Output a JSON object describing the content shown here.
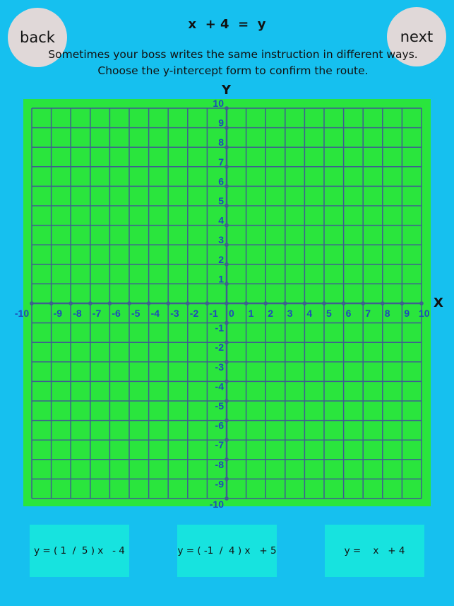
{
  "nav": {
    "back_label": "back",
    "next_label": "next"
  },
  "equation": "x  + 4  =  y",
  "instruction": "Sometimes your boss writes the same instruction in different ways. Choose the y-intercept form to confirm the route.",
  "graph": {
    "x_axis_label": "X",
    "y_axis_label": "Y",
    "x_range": [
      -10,
      10
    ],
    "y_range": [
      -10,
      10
    ],
    "step": 1,
    "x_ticks": [
      "-10",
      "-9",
      "-8",
      "-7",
      "-6",
      "-5",
      "-4",
      "-3",
      "-2",
      "-1",
      "0",
      "1",
      "2",
      "3",
      "4",
      "5",
      "6",
      "7",
      "8",
      "9",
      "10"
    ],
    "y_ticks": [
      "10",
      "9",
      "8",
      "7",
      "6",
      "5",
      "4",
      "3",
      "2",
      "1",
      "-1",
      "-2",
      "-3",
      "-4",
      "-5",
      "-6",
      "-7",
      "-8",
      "-9",
      "-10"
    ],
    "colors": {
      "background": "#16c0ef",
      "panel": "#2ae53d",
      "grid": "#3f5f8f",
      "labels": "#1f4bb8"
    }
  },
  "answers": [
    {
      "label": "y = ( 1  /  5 ) x   - 4"
    },
    {
      "label": "y = ( -1  /  4 ) x   + 5"
    },
    {
      "label": "y =    x   + 4"
    }
  ]
}
